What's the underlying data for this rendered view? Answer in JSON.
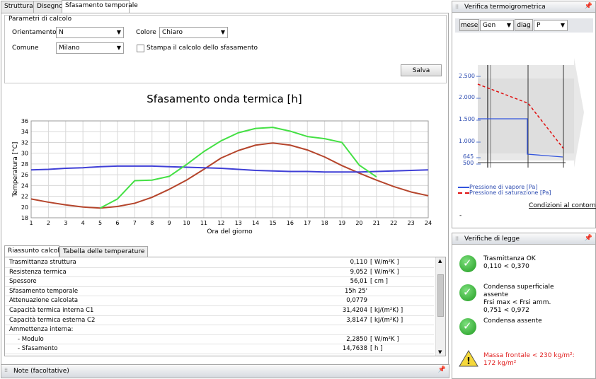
{
  "tabs": [
    {
      "label": "Struttura"
    },
    {
      "label": "Disegno"
    },
    {
      "label": "Sfasamento temporale"
    }
  ],
  "params": {
    "group_title": "Parametri di calcolo",
    "orientamento_label": "Orientamento",
    "orientamento_value": "N",
    "colore_label": "Colore",
    "colore_value": "Chiaro",
    "comune_label": "Comune",
    "comune_value": "Milano",
    "stampa_label": "Stampa il calcolo dello sfasamento",
    "stampa_checked": false,
    "save_label": "Salva"
  },
  "chart_data": {
    "type": "line",
    "title": "Sfasamento onda termica [h]",
    "xlabel": "Ora del giorno",
    "ylabel": "Temperatura [°C]",
    "xlim": [
      1,
      24
    ],
    "ylim": [
      18,
      36
    ],
    "x": [
      1,
      2,
      3,
      4,
      5,
      6,
      7,
      8,
      9,
      10,
      11,
      12,
      13,
      14,
      15,
      16,
      17,
      18,
      19,
      20,
      21,
      22,
      23,
      24
    ],
    "yticks": [
      18,
      20,
      22,
      24,
      26,
      28,
      30,
      32,
      34,
      36
    ],
    "grid": true,
    "series": [
      {
        "color": "#b5452c",
        "x": [
          1,
          2,
          3,
          4,
          5,
          6,
          7,
          8,
          9,
          10,
          11,
          12,
          13,
          14,
          15,
          16,
          17,
          18,
          19,
          20,
          21,
          22,
          23,
          24
        ],
        "values": [
          21.5,
          20.9,
          20.4,
          20.0,
          19.8,
          20.1,
          20.7,
          21.8,
          23.3,
          25.0,
          27.0,
          29.1,
          30.5,
          31.5,
          31.9,
          31.5,
          30.6,
          29.3,
          27.7,
          26.3,
          25.0,
          23.8,
          22.8,
          22.1
        ]
      },
      {
        "color": "#3f3fd6",
        "x": [
          1,
          2,
          3,
          4,
          5,
          6,
          7,
          8,
          9,
          10,
          11,
          12,
          13,
          14,
          15,
          16,
          17,
          18,
          19,
          20,
          21,
          22,
          23,
          24
        ],
        "values": [
          26.9,
          27.0,
          27.2,
          27.3,
          27.5,
          27.6,
          27.6,
          27.6,
          27.5,
          27.4,
          27.3,
          27.2,
          27.0,
          26.8,
          26.7,
          26.6,
          26.6,
          26.5,
          26.5,
          26.5,
          26.6,
          26.7,
          26.8,
          26.9
        ]
      },
      {
        "color": "#44e044",
        "x": [
          5,
          6,
          7,
          8,
          9,
          10,
          11,
          12,
          13,
          14,
          15,
          16,
          17,
          18,
          19,
          20,
          21
        ],
        "values": [
          19.8,
          21.5,
          24.9,
          25.0,
          25.7,
          27.9,
          30.3,
          32.3,
          33.8,
          34.6,
          34.8,
          34.1,
          33.1,
          32.7,
          32.0,
          27.8,
          25.6
        ]
      }
    ]
  },
  "bottom_tabs": [
    {
      "label": "Riassunto calcolo"
    },
    {
      "label": "Tabella delle temperature"
    }
  ],
  "summary_rows": [
    {
      "name": "Trasmittanza struttura",
      "value": "0,110",
      "unit": "[ W/m²K ]"
    },
    {
      "name": "Resistenza termica",
      "value": "9,052",
      "unit": "[ W/m²K ]"
    },
    {
      "name": "Spessore",
      "value": "56,01",
      "unit": "[ cm ]"
    },
    {
      "name": "Sfasamento temporale",
      "value": "15h 25'",
      "unit": ""
    },
    {
      "name": "Attenuazione calcolata",
      "value": "0,0779",
      "unit": ""
    },
    {
      "name": "Capacità termica interna C1",
      "value": "31,4204",
      "unit": "[ kJ/(m²K) ]"
    },
    {
      "name": "Capacità termica esterna C2",
      "value": "3,8147",
      "unit": "[ kJ/(m²K) ]"
    },
    {
      "name": "Ammettenza interna:",
      "value": "",
      "unit": ""
    },
    {
      "name": "- Modulo",
      "value": "2,2850",
      "unit": "[ W/m²K ]"
    },
    {
      "name": "- Sfasamento",
      "value": "14,7638",
      "unit": "[ h ]"
    }
  ],
  "notes_bar": {
    "label": "Note (facoltative)"
  },
  "verifica": {
    "title": "Verifica termoigrometrica",
    "mese_label": "mese",
    "mese_value": "Gen",
    "diag_label": "diag",
    "diag_value": "P",
    "y_ticks": [
      "2.500",
      "2.000",
      "1.500",
      "1.000",
      "645",
      "500"
    ],
    "legend_vapore": "Pressione di vapore [Pa]",
    "legend_saturazione": "Pressione di saturazione [Pa]",
    "condizioni_link": "Condizioni al contorno",
    "dash_text": "-"
  },
  "verifiche_legge": {
    "title": "Verifiche di legge",
    "items": [
      {
        "status": "ok",
        "lines": [
          "Trasmittanza OK",
          "0,110 < 0,370"
        ]
      },
      {
        "status": "ok",
        "lines": [
          "Condensa superficiale",
          "assente",
          "Frsi max < Frsi amm.",
          "0,751 < 0,972"
        ]
      },
      {
        "status": "ok",
        "lines": [
          "Condensa assente"
        ]
      },
      {
        "status": "warning",
        "lines": [
          "Massa frontale < 230 kg/m²:",
          "172 kg/m²"
        ]
      }
    ]
  },
  "colors": {
    "ok": "#2aa52a",
    "warning_text": "#e02020",
    "warning_icon": "#f5d83a"
  }
}
